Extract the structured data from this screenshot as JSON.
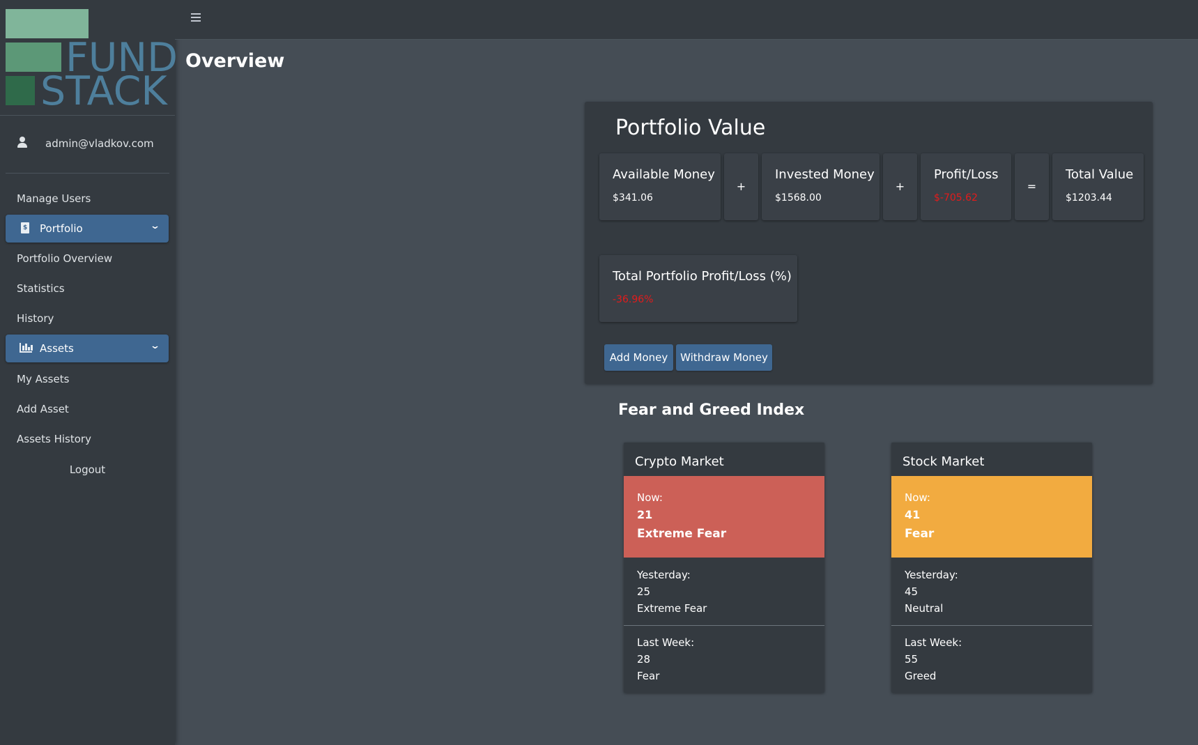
{
  "brand": {
    "line1": "FUND",
    "line2": "STACK"
  },
  "user": {
    "email": "admin@vladkov.com"
  },
  "sidebar": {
    "manage_users": "Manage Users",
    "portfolio": "Portfolio",
    "portfolio_overview": "Portfolio Overview",
    "statistics": "Statistics",
    "history": "History",
    "assets": "Assets",
    "my_assets": "My Assets",
    "add_asset": "Add Asset",
    "assets_history": "Assets History",
    "logout": "Logout"
  },
  "page": {
    "title": "Overview"
  },
  "portfolio": {
    "title": "Portfolio Value",
    "available": {
      "label": "Available Money",
      "value": "$341.06"
    },
    "invested": {
      "label": "Invested Money",
      "value": "$1568.00"
    },
    "profit_loss": {
      "label": "Profit/Loss",
      "value": "$-705.62"
    },
    "total": {
      "label": "Total Value",
      "value": "$1203.44"
    },
    "op_plus1": "+",
    "op_plus2": "+",
    "op_equals": "=",
    "total_pl": {
      "label": "Total Portfolio Profit/Loss (%)",
      "value": "-36.96%"
    },
    "add_money": "Add Money",
    "withdraw_money": "Withdraw Money"
  },
  "fear_greed": {
    "title": "Fear and Greed Index",
    "crypto": {
      "header": "Crypto Market",
      "now_label": "Now:",
      "now_value": "21",
      "now_text": "Extreme Fear",
      "now_color": "#cc6057",
      "yesterday_label": "Yesterday:",
      "yesterday_value": "25",
      "yesterday_text": "Extreme Fear",
      "lastweek_label": "Last Week:",
      "lastweek_value": "28",
      "lastweek_text": "Fear"
    },
    "stock": {
      "header": "Stock Market",
      "now_label": "Now:",
      "now_value": "41",
      "now_text": "Fear",
      "now_color": "#f2ab40",
      "yesterday_label": "Yesterday:",
      "yesterday_value": "45",
      "yesterday_text": "Neutral",
      "lastweek_label": "Last Week:",
      "lastweek_value": "55",
      "lastweek_text": "Greed"
    }
  }
}
